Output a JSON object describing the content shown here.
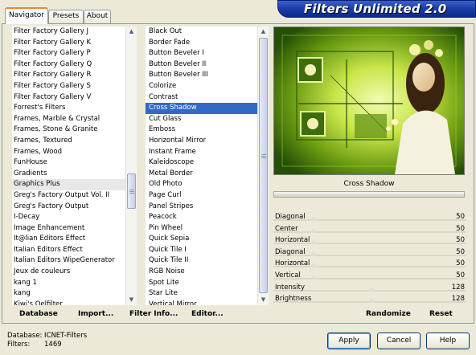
{
  "banner": {
    "title": "Filters Unlimited 2.0"
  },
  "tabs": [
    {
      "label": "Navigator",
      "active": true
    },
    {
      "label": "Presets",
      "active": false
    },
    {
      "label": "About",
      "active": false
    }
  ],
  "categories": {
    "items": [
      "Filter Factory Gallery J",
      "Filter Factory Gallery K",
      "Filter Factory Gallery P",
      "Filter Factory Gallery Q",
      "Filter Factory Gallery R",
      "Filter Factory Gallery S",
      "Filter Factory Gallery V",
      "Forrest's Filters",
      "Frames, Marble & Crystal",
      "Frames, Stone & Granite",
      "Frames, Textured",
      "Frames, Wood",
      "FunHouse",
      "Gradients",
      "Graphics Plus",
      "Greg's Factory Output Vol. II",
      "Greg's Factory Output",
      "I-Decay",
      "Image Enhancement",
      "It@lian Editors Effect",
      "Italian Editors Effect",
      "Italian Editors WipeGenerator",
      "Jeux de couleurs",
      "kang 1",
      "kang",
      "Kiwi's Oelfilter"
    ],
    "current": "Graphics Plus"
  },
  "filters": {
    "items": [
      "Black Out",
      "Border Fade",
      "Button Beveler I",
      "Button Beveler II",
      "Button Beveler III",
      "Colorize",
      "Contrast",
      "Cross Shadow",
      "Cut Glass",
      "Emboss",
      "Horizontal Mirror",
      "Instant Frame",
      "Kaleidoscope",
      "Metal Border",
      "Old Photo",
      "Page Curl",
      "Panel Stripes",
      "Peacock",
      "Pin Wheel",
      "Quick Sepia",
      "Quick Tile I",
      "Quick Tile II",
      "RGB Noise",
      "Spot Lite",
      "Star Lite",
      "Vertical Mirror"
    ],
    "selected": "Cross Shadow"
  },
  "preview": {
    "filter_name": "Cross Shadow"
  },
  "parameters": [
    {
      "label": "Diagonal",
      "value": "50",
      "level": 0.196
    },
    {
      "label": "Center",
      "value": "50",
      "level": 0.196
    },
    {
      "label": "Horizontal",
      "value": "50",
      "level": 0.196
    },
    {
      "label": "Diagonal",
      "value": "50",
      "level": 0.196
    },
    {
      "label": "Horizontal",
      "value": "50",
      "level": 0.196
    },
    {
      "label": "Vertical",
      "value": "50",
      "level": 0.196
    },
    {
      "label": "Intensity",
      "value": "128",
      "level": 0.502
    },
    {
      "label": "Brightness",
      "value": "128",
      "level": 0.502
    }
  ],
  "actions": {
    "database": "Database",
    "import": "Import...",
    "filter_info": "Filter Info...",
    "editor": "Editor...",
    "randomize": "Randomize",
    "reset": "Reset"
  },
  "status": {
    "database_label": "Database:",
    "database_value": "ICNET-Filters",
    "filters_label": "Filters:",
    "filters_value": "1469"
  },
  "buttons": {
    "apply": "Apply",
    "cancel": "Cancel",
    "help": "Help"
  },
  "colors": {
    "selection": "#316ac5",
    "banner": "#1e3fa8",
    "tab_accent": "#e68b2c"
  }
}
